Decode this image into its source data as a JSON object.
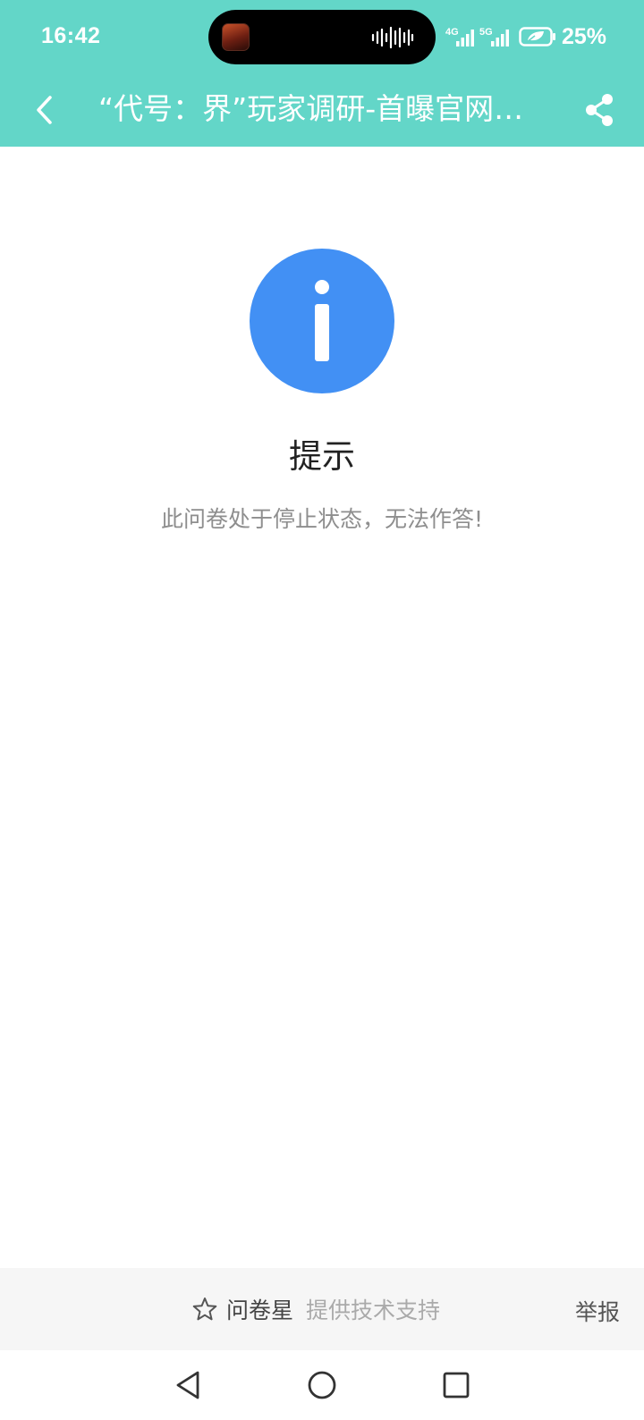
{
  "status_bar": {
    "time": "16:42",
    "network_1": "4G",
    "network_2": "5G",
    "battery": "25%"
  },
  "header": {
    "title": "“代号：界”玩家调研-首曝官网…",
    "back_icon": "chevron-left-icon",
    "share_icon": "share-icon"
  },
  "notice": {
    "icon": "info-icon",
    "title": "提示",
    "message": "此问卷处于停止状态，无法作答!"
  },
  "footer": {
    "brand_icon": "star-outline-icon",
    "brand_name": "问卷星",
    "support_text": "提供技术支持",
    "report_label": "举报"
  },
  "colors": {
    "header_bg": "#63d6c8",
    "info_icon_bg": "#4290f4",
    "title_text": "#222222",
    "message_text": "#8e8e8e",
    "footer_bg": "#f6f6f6"
  }
}
